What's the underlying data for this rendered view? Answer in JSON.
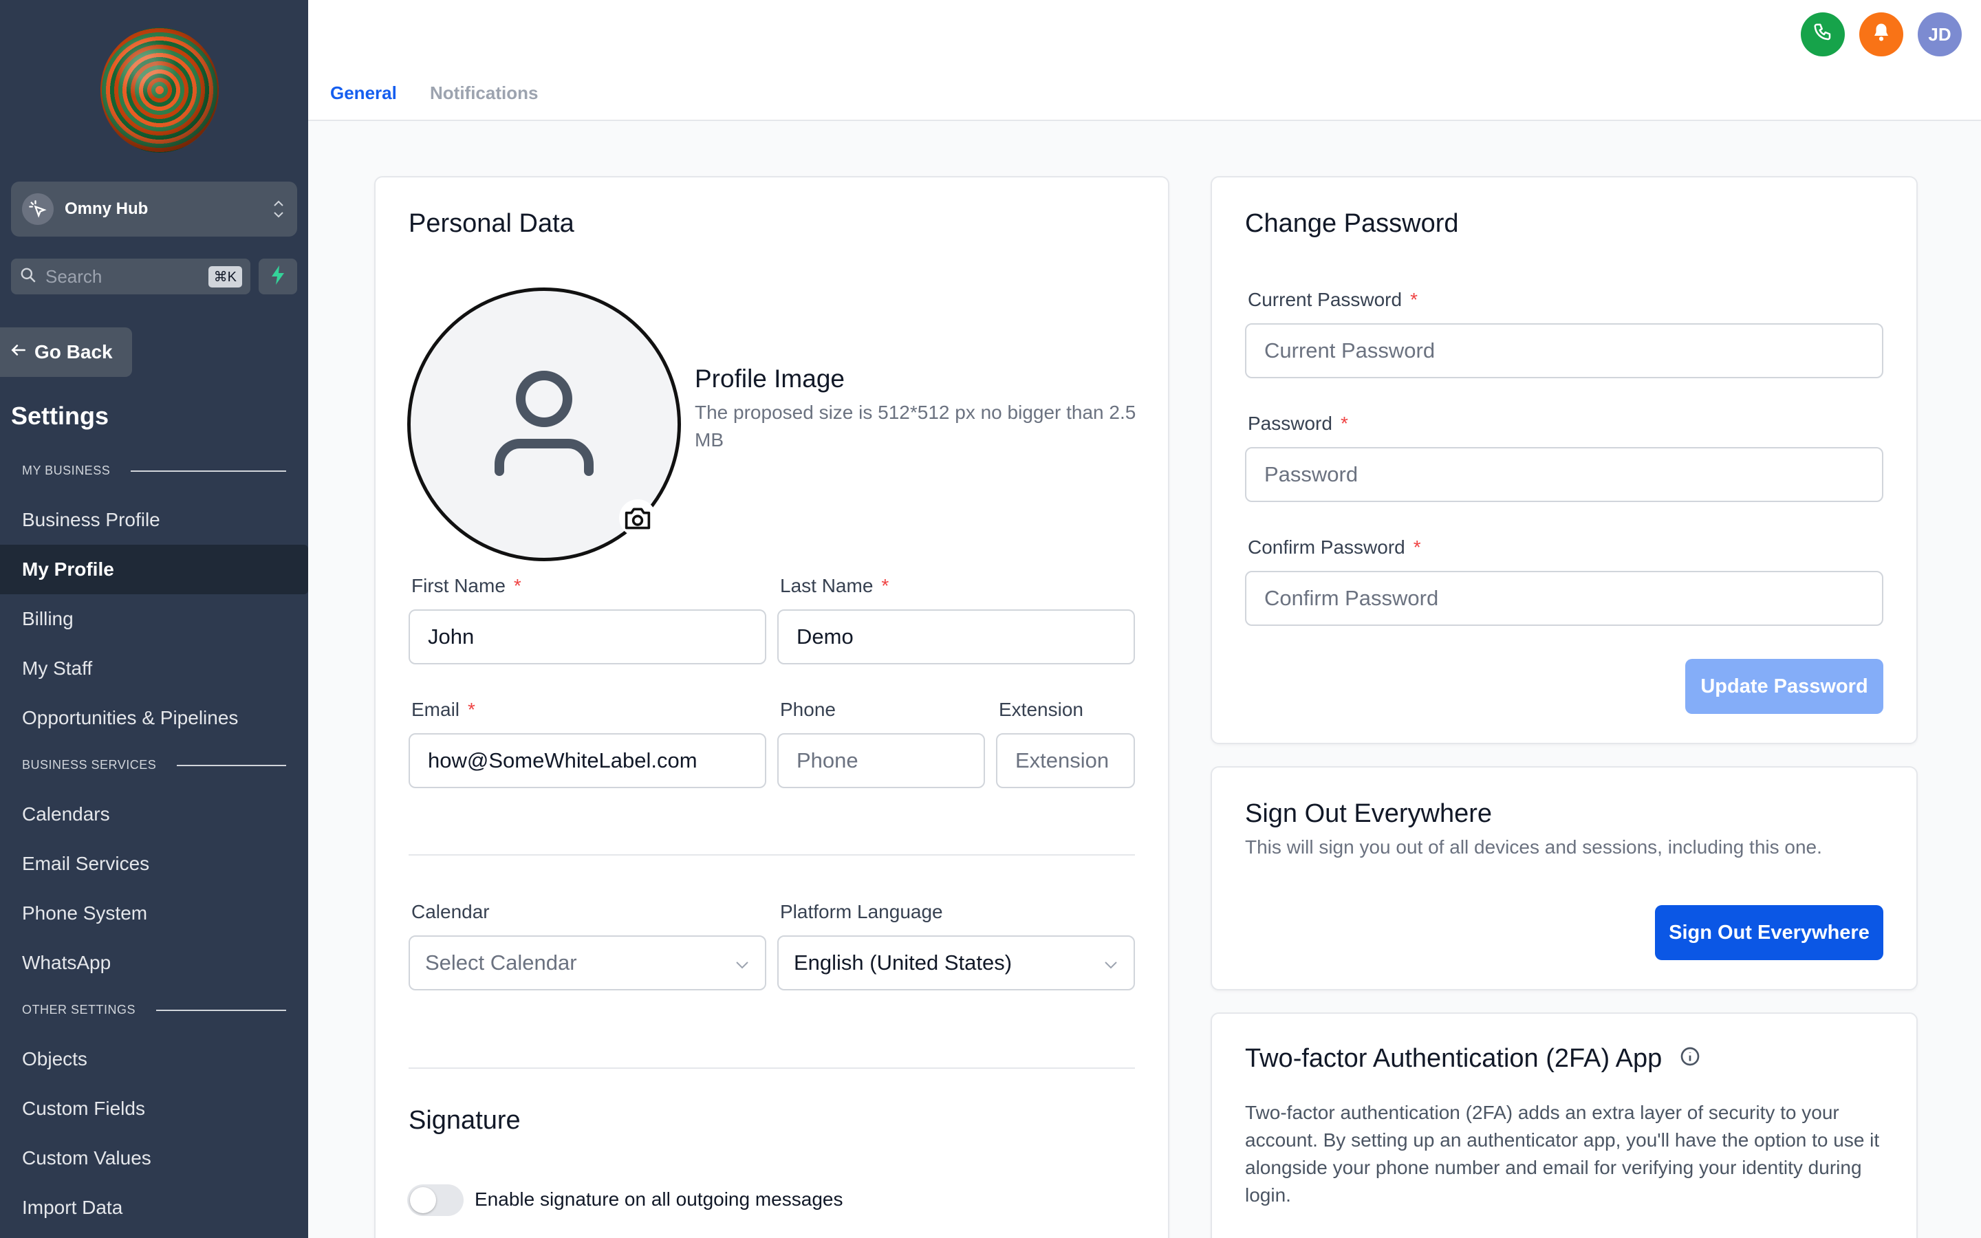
{
  "sidebar": {
    "account_name": "Omny Hub",
    "search_placeholder": "Search",
    "search_shortcut": "⌘K",
    "go_back": "Go Back",
    "settings_title": "Settings",
    "sections": {
      "my_business": "MY BUSINESS",
      "business_services": "BUSINESS SERVICES",
      "other_settings": "OTHER SETTINGS"
    },
    "items": [
      {
        "label": "Business Profile"
      },
      {
        "label": "My Profile",
        "active": true
      },
      {
        "label": "Billing"
      },
      {
        "label": "My Staff"
      },
      {
        "label": "Opportunities & Pipelines"
      },
      {
        "label": "Calendars"
      },
      {
        "label": "Email Services"
      },
      {
        "label": "Phone System"
      },
      {
        "label": "WhatsApp"
      },
      {
        "label": "Objects"
      },
      {
        "label": "Custom Fields"
      },
      {
        "label": "Custom Values"
      },
      {
        "label": "Import Data"
      }
    ]
  },
  "header": {
    "tabs": [
      {
        "label": "General",
        "active": true
      },
      {
        "label": "Notifications"
      }
    ],
    "avatar_initials": "JD"
  },
  "personal_data": {
    "title": "Personal Data",
    "profile_image_title": "Profile Image",
    "profile_image_hint": "The proposed size is 512*512 px no bigger than 2.5 MB",
    "first_name_label": "First Name",
    "first_name_value": "John",
    "last_name_label": "Last Name",
    "last_name_value": "Demo",
    "email_label": "Email",
    "email_value": "how@SomeWhiteLabel.com",
    "phone_label": "Phone",
    "phone_placeholder": "Phone",
    "extension_label": "Extension",
    "extension_placeholder": "Extension",
    "calendar_label": "Calendar",
    "calendar_value": "Select Calendar",
    "language_label": "Platform Language",
    "language_value": "English (United States)",
    "signature_title": "Signature",
    "signature_toggle_label": "Enable signature on all outgoing messages",
    "required_mark": "*"
  },
  "change_password": {
    "title": "Change Password",
    "current_label": "Current Password",
    "current_placeholder": "Current Password",
    "password_label": "Password",
    "password_placeholder": "Password",
    "confirm_label": "Confirm Password",
    "confirm_placeholder": "Confirm Password",
    "button": "Update Password"
  },
  "sign_out": {
    "title": "Sign Out Everywhere",
    "description": "This will sign you out of all devices and sessions, including this one.",
    "button": "Sign Out Everywhere"
  },
  "two_factor": {
    "title": "Two-factor Authentication (2FA) App",
    "description": "Two-factor authentication (2FA) adds an extra layer of security to your account. By setting up an authenticator app, you'll have the option to use it alongside your phone number and email for verifying your identity during login."
  },
  "colors": {
    "sidebar_bg": "#2e3a4f",
    "primary": "#0b57e5",
    "active_tab": "#155eef",
    "phone_green": "#16a34a",
    "bell_orange": "#f97316"
  }
}
